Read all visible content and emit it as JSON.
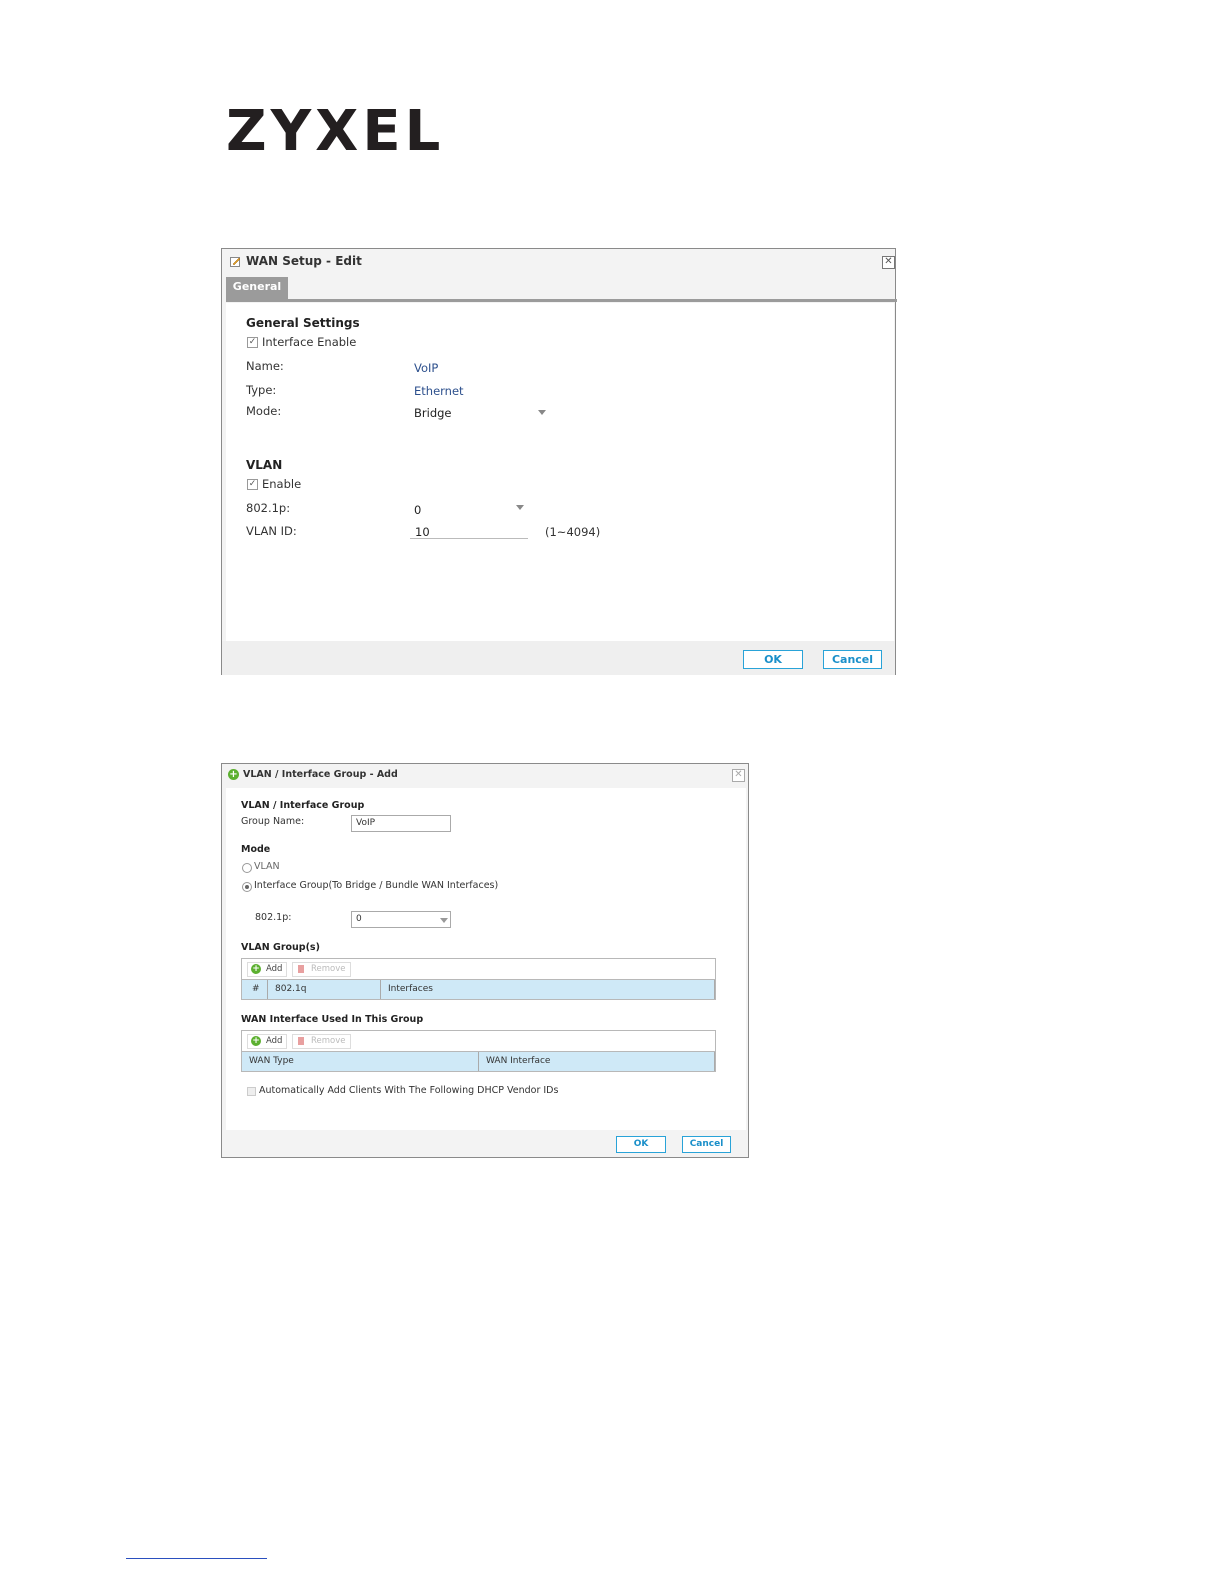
{
  "logo": {
    "text": "ZYXEL"
  },
  "wan_edit": {
    "title": "WAN Setup - Edit",
    "tab": "General",
    "general_settings": {
      "heading": "General Settings",
      "interface_enable_label": "Interface Enable",
      "name_label": "Name:",
      "name_value": "VoIP",
      "type_label": "Type:",
      "type_value": "Ethernet",
      "mode_label": "Mode:",
      "mode_value": "Bridge"
    },
    "vlan": {
      "heading": "VLAN",
      "enable_label": "Enable",
      "p8021_label": "802.1p:",
      "p8021_value": "0",
      "vlan_id_label": "VLAN ID:",
      "vlan_id_value": "10",
      "vlan_id_range": "(1~4094)"
    },
    "buttons": {
      "ok": "OK",
      "cancel": "Cancel"
    }
  },
  "vlan_group_add": {
    "title": "VLAN / Interface Group - Add",
    "section_heading": "VLAN / Interface Group",
    "group_name_label": "Group Name:",
    "group_name_value": "VoIP",
    "mode": {
      "heading": "Mode",
      "option_vlan": "VLAN",
      "option_interface_group": "Interface Group(To Bridge / Bundle WAN Interfaces)",
      "selected": "Interface Group(To Bridge / Bundle WAN Interfaces)"
    },
    "p8021_label": "802.1p:",
    "p8021_value": "0",
    "vlan_groups": {
      "heading": "VLAN Group(s)",
      "add_label": "Add",
      "remove_label": "Remove",
      "columns": [
        "#",
        "802.1q",
        "Interfaces"
      ]
    },
    "wan_interface": {
      "heading": "WAN Interface Used In This Group",
      "add_label": "Add",
      "remove_label": "Remove",
      "columns": [
        "WAN Type",
        "WAN Interface"
      ]
    },
    "auto_add_label": "Automatically Add Clients With The Following DHCP Vendor IDs",
    "buttons": {
      "ok": "OK",
      "cancel": "Cancel"
    }
  }
}
